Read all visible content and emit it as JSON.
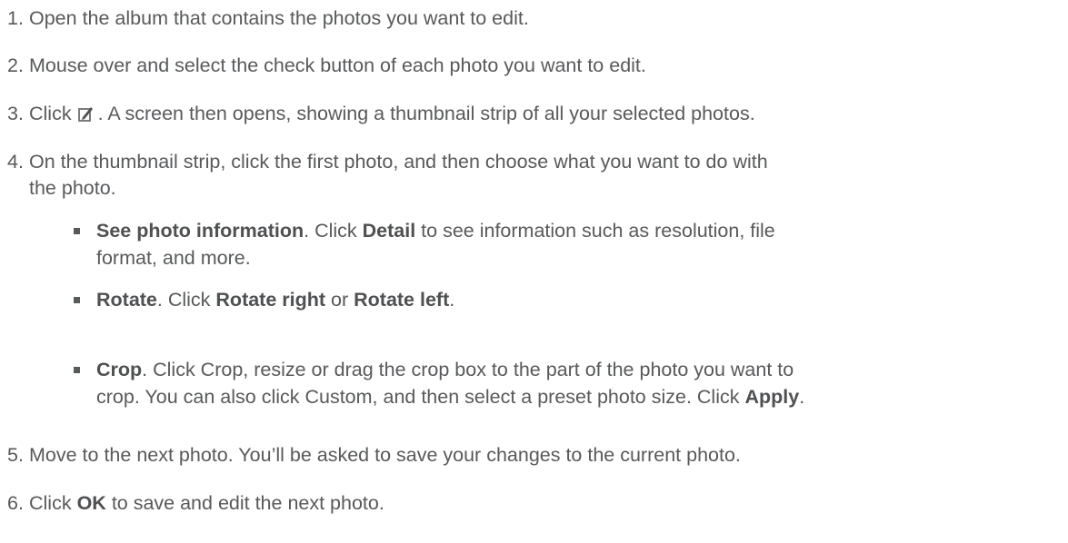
{
  "steps": [
    {
      "number": "1.",
      "text": "Open the album that contains the photos you want to edit."
    },
    {
      "number": "2.",
      "text": "Mouse over and select the check button of each photo you want to edit."
    },
    {
      "number": "3.",
      "prefix": "Click",
      "icon": "edit-photo-icon",
      "text": ". A screen then opens, showing a thumbnail strip of all your selected photos."
    },
    {
      "number": "4.",
      "line1": "On the thumbnail strip, click the first photo, and then choose what you want to do with",
      "line2": "the photo."
    },
    {
      "number": "5.",
      "text": "Move to the next photo. You’ll be asked to save your changes to the current photo."
    },
    {
      "number": "6.",
      "prefix": "Click",
      "bold": "OK",
      "text": "to save and edit the next photo."
    }
  ],
  "substeps": [
    {
      "bold": "See photo information",
      "text1": ". Click ",
      "bold2": "Detail",
      "text2": " to see information such as resolution, file",
      "line2": "format, and more."
    },
    {
      "bold": "Rotate",
      "text1": ". Click ",
      "bold2": "Rotate right",
      "text2": " or ",
      "bold3": "Rotate left",
      "text3": "."
    },
    {
      "bold": "Crop",
      "text1": ". Click Crop, resize or drag the crop box to the part of the photo you want to",
      "line2a": "crop. You can also click Custom, and then select a preset photo size. Click ",
      "line2bold": "Apply",
      "line2end": "."
    }
  ],
  "colors": {
    "text": "#58595b"
  }
}
